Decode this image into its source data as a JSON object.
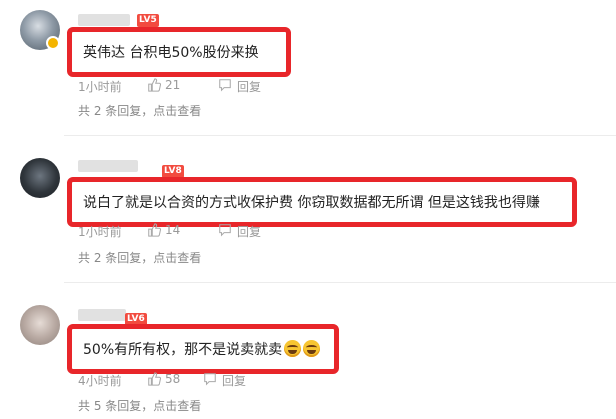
{
  "comments": [
    {
      "level_badge": "LV5",
      "text": "英伟达 台积电50%股份来换",
      "time": "1小时前",
      "likes": "21",
      "reply_label": "回复",
      "replies_link": "共 2 条回复，点击查看"
    },
    {
      "level_badge": "LV8",
      "text": "说白了就是以合资的方式收保护费 你窃取数据都无所谓 但是这钱我也得赚",
      "time": "1小时前",
      "likes": "14",
      "reply_label": "回复",
      "replies_link": "共 2 条回复，点击查看"
    },
    {
      "level_badge": "LV6",
      "text": "50%有所有权，那不是说卖就卖",
      "time": "4小时前",
      "likes": "58",
      "reply_label": "回复",
      "replies_link": "共 5 条回复，点击查看"
    }
  ],
  "icons": {
    "like": "thumbs-up-icon",
    "reply": "comment-bubble-icon",
    "emoji": "laughing-tears-emoji"
  },
  "colors": {
    "highlight_border": "#e8262a",
    "level_badge": "#f24b3f",
    "meta_text": "#9a9a9a"
  }
}
